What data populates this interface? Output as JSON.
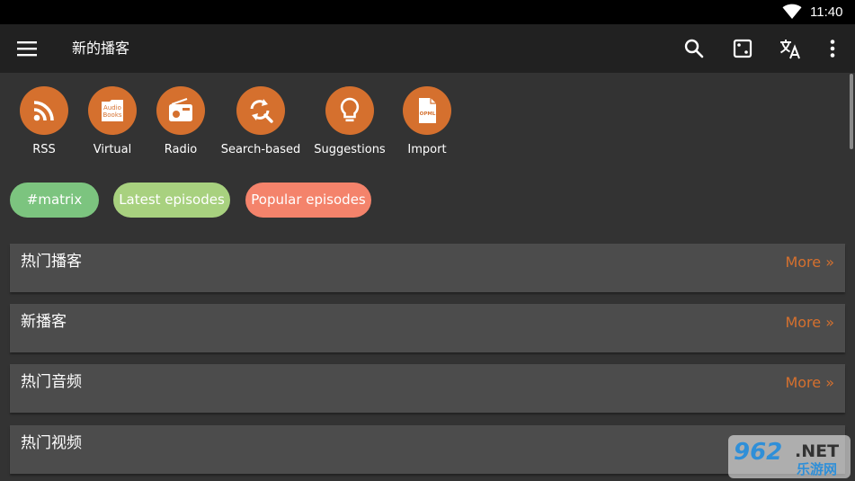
{
  "status_bar": {
    "time": "11:40"
  },
  "toolbar": {
    "title": "新的播客"
  },
  "categories": [
    {
      "label": "RSS",
      "icon": "rss-icon"
    },
    {
      "label": "Virtual",
      "icon": "audio-books-icon",
      "icon_text_line1": "Audio",
      "icon_text_line2": "Books"
    },
    {
      "label": "Radio",
      "icon": "radio-icon"
    },
    {
      "label": "Search-based",
      "icon": "search-refresh-icon"
    },
    {
      "label": "Suggestions",
      "icon": "lightbulb-icon"
    },
    {
      "label": "Import",
      "icon": "opml-file-icon",
      "icon_text": "OPML"
    }
  ],
  "tags": [
    {
      "label": "#matrix",
      "color": "#7cc47f"
    },
    {
      "label": "Latest episodes",
      "color": "#a8d17f"
    },
    {
      "label": "Popular episodes",
      "color": "#f4836b"
    }
  ],
  "sections": [
    {
      "title": "热门播客",
      "more": "More »"
    },
    {
      "title": "新播客",
      "more": "More »"
    },
    {
      "title": "热门音频",
      "more": "More »"
    },
    {
      "title": "热门视频",
      "more": ""
    }
  ],
  "watermark": {
    "main": "962",
    "suffix": ".NET",
    "sub": "乐游网"
  },
  "colors": {
    "accent": "#d5702e",
    "toolbar": "#212121",
    "background": "#333333",
    "card": "#4c4c4c"
  }
}
